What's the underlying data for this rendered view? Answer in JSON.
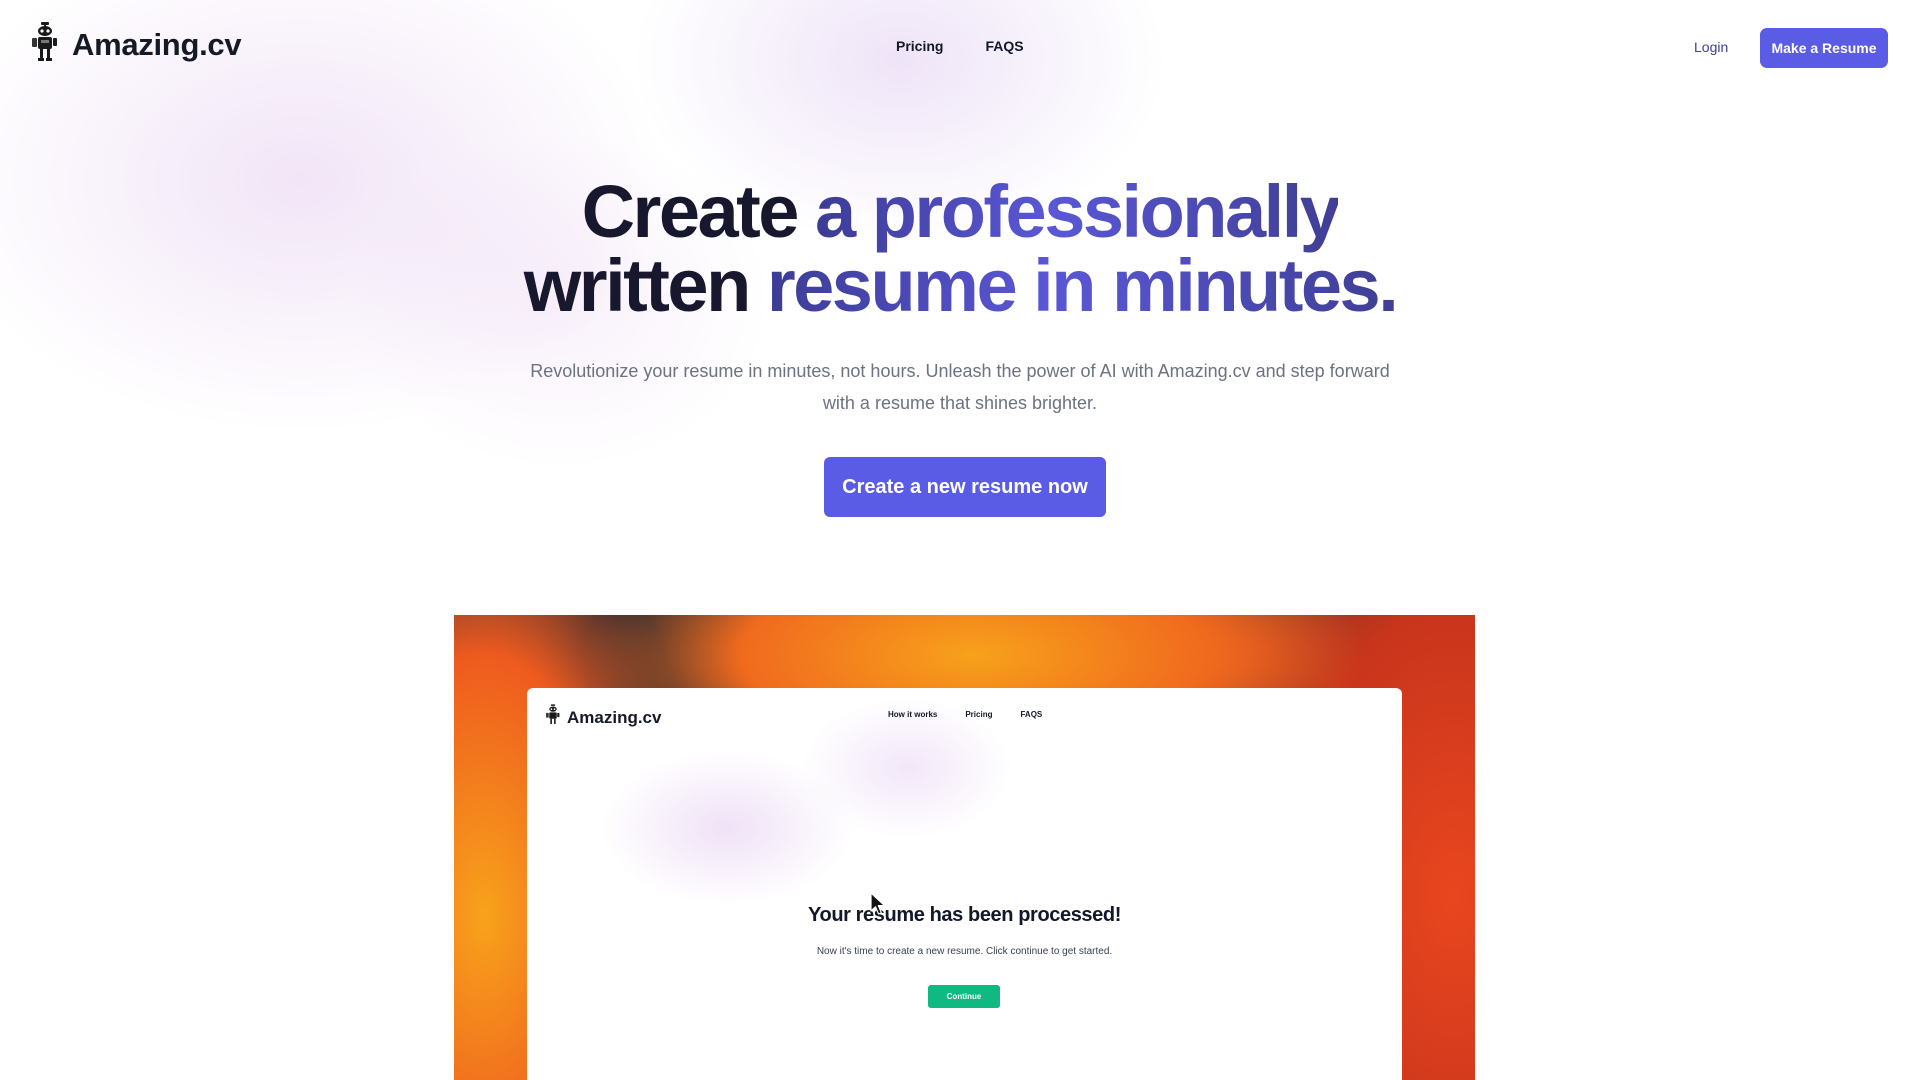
{
  "nav": {
    "brand": "Amazing.cv",
    "links": [
      "Pricing",
      "FAQS"
    ],
    "login": "Login",
    "cta": "Make a Resume",
    "logo_icon": "robot-icon"
  },
  "hero": {
    "headline_line1_a": "Create ",
    "headline_line1_b": "a professionally",
    "headline_line2_a": "written ",
    "headline_line2_b": "resume in minutes.",
    "subtext": "Revolutionize your resume in minutes, not hours. Unleash the power of AI with Amazing.cv and step forward with a resume that shines brighter.",
    "cta": "Create a new resume now"
  },
  "preview": {
    "brand": "Amazing.cv",
    "links": [
      "How it works",
      "Pricing",
      "FAQS"
    ],
    "title": "Your resume has been processed!",
    "subtitle": "Now it's time to create a new resume. Click continue to get started.",
    "button": "Continue",
    "cursor_icon": "mouse-pointer-icon"
  },
  "colors": {
    "primary": "#5b5ce6",
    "headline_dark": "#17172e",
    "headline_accent": "#5a57d6",
    "continue_green": "#10b981",
    "preview_bg": "#0f2233"
  }
}
